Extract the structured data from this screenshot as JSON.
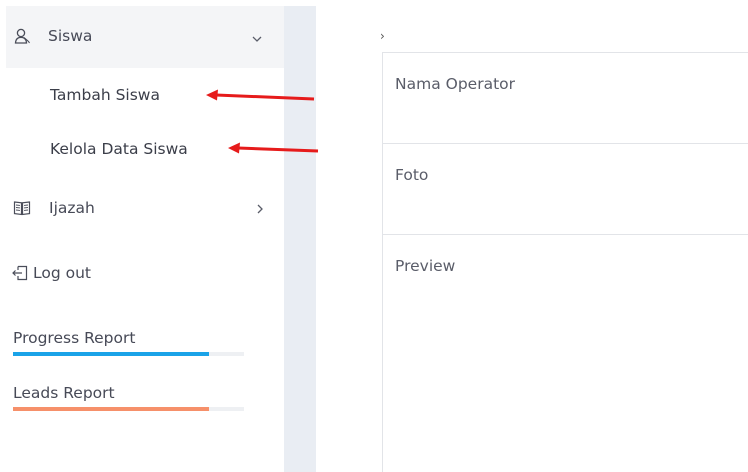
{
  "sidebar": {
    "siswa": {
      "label": "Siswa",
      "icon": "user-icon"
    },
    "submenu": [
      {
        "label": "Tambah Siswa"
      },
      {
        "label": "Kelola Data Siswa"
      }
    ],
    "ijazah": {
      "label": "Ijazah",
      "icon": "book-icon"
    },
    "logout": {
      "label": "Log out",
      "icon": "logout-icon"
    },
    "reports": [
      {
        "label": "Progress Report",
        "progress": 0.85,
        "color": "#1aa3e8"
      },
      {
        "label": "Leads Report",
        "progress": 0.85,
        "color": "#f6906a"
      }
    ]
  },
  "content": {
    "breadcrumb_chevron": "›",
    "fields": [
      {
        "label": "Nama Operator"
      },
      {
        "label": "Foto"
      },
      {
        "label": "Preview"
      }
    ]
  },
  "annotations": {
    "arrow_color": "#e61b1b"
  }
}
